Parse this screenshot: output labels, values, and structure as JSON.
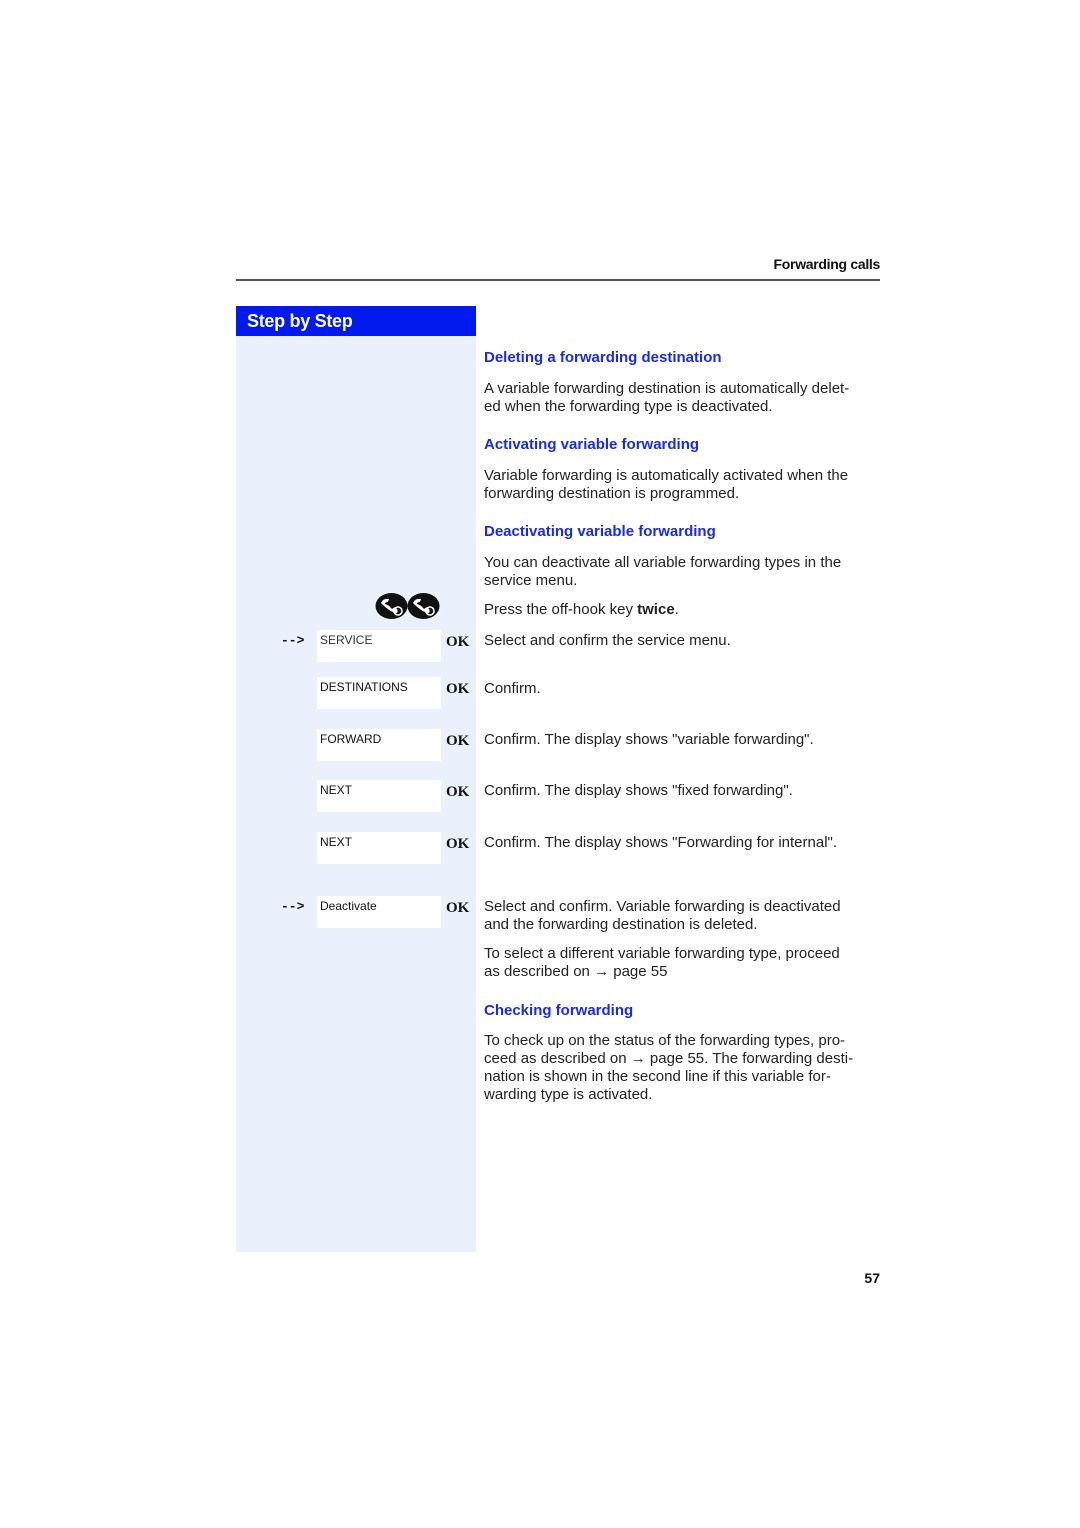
{
  "header": {
    "section_title": "Forwarding calls"
  },
  "sidebar": {
    "title": "Step by Step",
    "icons": [
      "off-hook-key-icon",
      "off-hook-key-icon"
    ],
    "steps": [
      {
        "display": "SERVICE",
        "key": "OK",
        "scroll_arrow": "-->"
      },
      {
        "display": "DESTINATIONS",
        "key": "OK"
      },
      {
        "display": "FORWARD",
        "key": "OK"
      },
      {
        "display": "NEXT",
        "key": "OK"
      },
      {
        "display": "NEXT",
        "key": "OK"
      },
      {
        "display": "Deactivate",
        "key": "OK",
        "scroll_arrow": "-->"
      }
    ]
  },
  "content": {
    "deleting": {
      "heading": "Deleting a forwarding destination",
      "line1": "A variable forwarding destination is automatically delet-",
      "line2": "ed when the forwarding type is deactivated."
    },
    "activating": {
      "heading": "Activating variable forwarding",
      "line1": "Variable forwarding is automatically activated when the",
      "line2": "forwarding destination is programmed."
    },
    "deactivating": {
      "heading": "Deactivating variable forwarding",
      "line1": "You can deactivate all variable forwarding types in the",
      "line2": "service menu.",
      "press_prefix": "Press the off-hook key ",
      "press_bold": "twice",
      "press_suffix": ".",
      "steps": [
        "Select and confirm the service menu.",
        "Confirm.",
        "Confirm. The display shows \"variable forwarding\".",
        "Confirm. The display shows \"fixed forwarding\".",
        "Confirm. The display shows \"Forwarding for internal\"."
      ],
      "final_line1": "Select and confirm. Variable forwarding is deactivated",
      "final_line2": "and the forwarding destination is deleted.",
      "other_line1": "To select a different variable forwarding type, proceed",
      "other_line2": "as described on → page 55"
    },
    "checking": {
      "heading": "Checking forwarding",
      "line1": "To check up on the status of the forwarding types, pro-",
      "line2": "ceed as described on → page 55. The forwarding desti-",
      "line3": "nation is shown in the second line if this variable for-",
      "line4": "warding type is activated."
    }
  },
  "footer": {
    "page_number": "57"
  },
  "colors": {
    "accent_blue": "#0219f0",
    "heading_blue": "#1a2be0",
    "band": "#eaf1fc"
  }
}
